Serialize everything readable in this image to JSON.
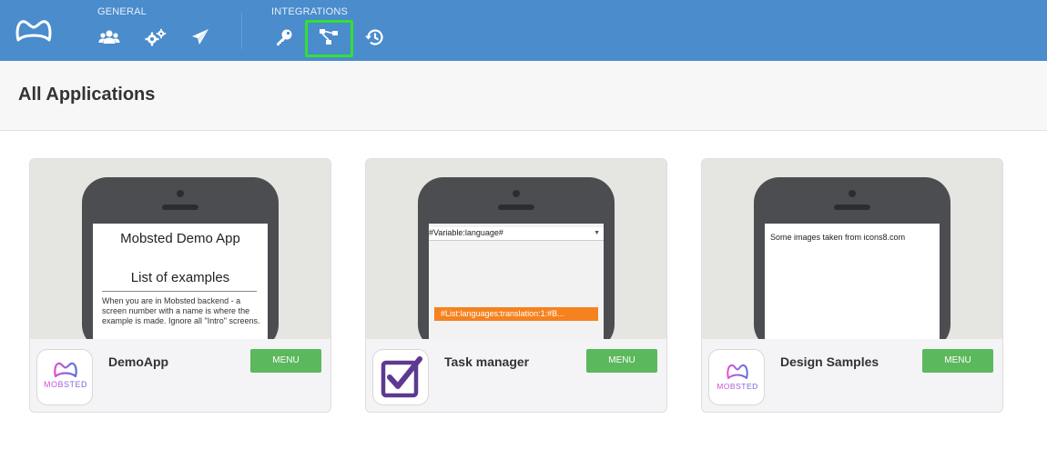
{
  "nav": {
    "general_label": "GENERAL",
    "integrations_label": "INTEGRATIONS",
    "general_icons": [
      "users-icon",
      "gears-icon",
      "paper-plane-icon"
    ],
    "integration_icons": [
      "key-icon",
      "sitemap-icon",
      "history-icon"
    ],
    "active_icon": "sitemap-icon"
  },
  "page": {
    "title": "All Applications"
  },
  "colors": {
    "topbar": "#4a8ccc",
    "menu_button": "#5cb85c",
    "highlight": "#33e033",
    "orange_button": "#f5821f"
  },
  "apps": [
    {
      "name": "DemoApp",
      "menu_label": "MENU",
      "icon_text": "MOBSTED",
      "preview": {
        "title": "Mobsted Demo App",
        "subtitle": "List of examples",
        "body": "When you are in Mobsted backend - a screen number with a name is where the example is made. Ignore all \"Intro\" screens."
      }
    },
    {
      "name": "Task manager",
      "menu_label": "MENU",
      "icon_text": "",
      "preview": {
        "select_value": "#Variable:language#",
        "button_text": "#List:languages:translation:1:#B..."
      }
    },
    {
      "name": "Design Samples",
      "menu_label": "MENU",
      "icon_text": "MOBSTED",
      "preview": {
        "text": "Some images taken from icons8.com"
      }
    }
  ]
}
